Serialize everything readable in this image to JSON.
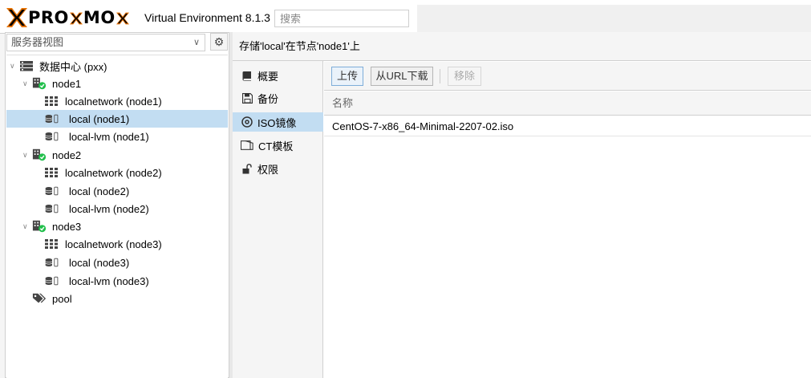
{
  "app": {
    "logo_text_1": "PRO",
    "logo_text_2": "MO",
    "version_label": "Virtual Environment 8.1.3",
    "search_placeholder": "搜索"
  },
  "sidebar": {
    "view_select": "服务器视图",
    "tree": [
      {
        "label": "数据中心 (pxx)",
        "icon": "datacenter-icon",
        "toggle": "expanded"
      },
      {
        "label": "node1",
        "icon": "node-online-icon",
        "toggle": "expanded"
      },
      {
        "label": "localnetwork (node1)",
        "icon": "network-grid-icon"
      },
      {
        "label": "local (node1)",
        "icon": "storage-icon",
        "selected": true
      },
      {
        "label": "local-lvm (node1)",
        "icon": "storage-icon"
      },
      {
        "label": "node2",
        "icon": "node-online-icon",
        "toggle": "expanded"
      },
      {
        "label": "localnetwork (node2)",
        "icon": "network-grid-icon"
      },
      {
        "label": "local (node2)",
        "icon": "storage-icon"
      },
      {
        "label": "local-lvm (node2)",
        "icon": "storage-icon"
      },
      {
        "label": "node3",
        "icon": "node-online-icon",
        "toggle": "expanded"
      },
      {
        "label": "localnetwork (node3)",
        "icon": "network-grid-icon"
      },
      {
        "label": "local (node3)",
        "icon": "storage-icon"
      },
      {
        "label": "local-lvm (node3)",
        "icon": "storage-icon"
      },
      {
        "label": "pool",
        "icon": "tags-icon"
      }
    ]
  },
  "content": {
    "title": "存储'local'在节点'node1'上",
    "nav": [
      {
        "label": "概要",
        "icon": "book-icon"
      },
      {
        "label": "备份",
        "icon": "floppy-icon"
      },
      {
        "label": "ISO镜像",
        "icon": "disc-icon",
        "active": true
      },
      {
        "label": "CT模板",
        "icon": "container-icon"
      },
      {
        "label": "权限",
        "icon": "unlock-icon"
      }
    ],
    "toolbar": {
      "upload": "上传",
      "download_url": "从URL下载",
      "remove": "移除"
    },
    "table": {
      "column_name": "名称",
      "rows": [
        "CentOS-7-x86_64-Minimal-2207-02.iso"
      ]
    }
  },
  "colors": {
    "selection": "#c2ddf2",
    "brand_orange": "#e57000",
    "online_green": "#21bf4b"
  }
}
